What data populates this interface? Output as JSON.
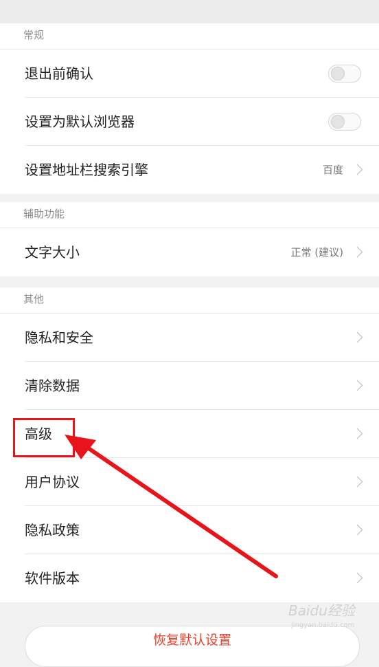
{
  "sections": {
    "general": {
      "title": "常规",
      "items": [
        {
          "label": "退出前确认",
          "toggle": "off"
        },
        {
          "label": "设置为默认浏览器",
          "toggle": "off"
        },
        {
          "label": "设置地址栏搜索引擎",
          "value": "百度"
        }
      ]
    },
    "accessibility": {
      "title": "辅助功能",
      "items": [
        {
          "label": "文字大小",
          "value": "正常 (建议)"
        }
      ]
    },
    "other": {
      "title": "其他",
      "items": [
        {
          "label": "隐私和安全"
        },
        {
          "label": "清除数据"
        },
        {
          "label": "高级"
        },
        {
          "label": "用户协议"
        },
        {
          "label": "隐私政策"
        },
        {
          "label": "软件版本"
        }
      ]
    }
  },
  "restore_button": "恢复默认设置",
  "watermark": {
    "brand": "Baidu经验",
    "url": "jingyan.baidu.com"
  },
  "colors": {
    "accent": "#e8141a",
    "restore_text": "#e8412c"
  }
}
